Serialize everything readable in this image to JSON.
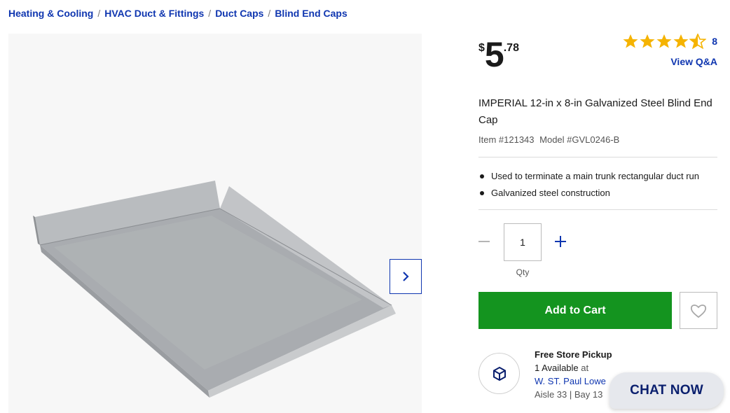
{
  "breadcrumb": [
    {
      "label": "Heating & Cooling"
    },
    {
      "label": "HVAC Duct & Fittings"
    },
    {
      "label": "Duct Caps"
    },
    {
      "label": "Blind End Caps"
    }
  ],
  "breadcrumb_separator": "/",
  "price": {
    "currency": "$",
    "whole": "5",
    "cents": ".78"
  },
  "rating": {
    "value": 4.5,
    "max": 5,
    "count": "8",
    "star_color": "#f5b301"
  },
  "view_qa": "View Q&A",
  "product": {
    "title": "IMPERIAL 12-in x 8-in Galvanized Steel Blind End Cap",
    "item_number": "Item #121343",
    "model_number": "Model #GVL0246-B",
    "bullets": [
      "Used to terminate a main trunk rectangular duct run",
      "Galvanized steel construction"
    ]
  },
  "quantity": {
    "value": "1",
    "label": "Qty"
  },
  "add_to_cart": "Add to Cart",
  "pickup": {
    "heading": "Free Store Pickup",
    "available": "1 Available",
    "at": " at",
    "store": "W. ST. Paul Lowe",
    "aisle": "Aisle 33 | Bay 13"
  },
  "chat": "CHAT NOW",
  "colors": {
    "link": "#0f36b0",
    "cart_button": "#14941f",
    "chat_text": "#0a1f6e"
  },
  "icons": [
    "chevron-right-icon",
    "star-icon",
    "minus-icon",
    "plus-icon",
    "heart-icon",
    "pickup-box-icon"
  ]
}
